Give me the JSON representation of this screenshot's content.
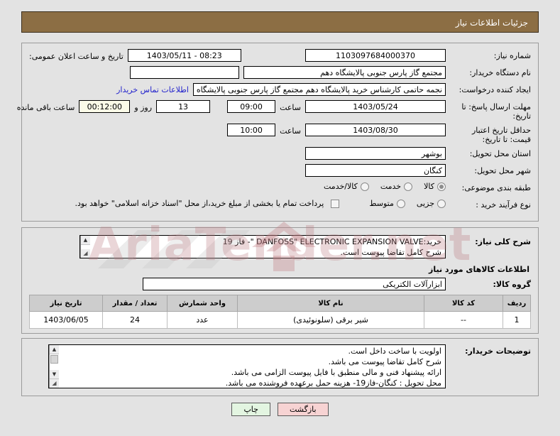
{
  "header": {
    "title": "جزئیات اطلاعات نیاز"
  },
  "watermark": {
    "text": "AriaTender.net"
  },
  "need_info": {
    "need_number_label": "شماره نیاز:",
    "need_number_value": "1103097684000370",
    "public_announce_label": "تاریخ و ساعت اعلان عمومی:",
    "public_announce_value": "08:23 - 1403/05/11",
    "buyer_org_label": "نام دستگاه خریدار:",
    "buyer_org_value": "مجتمع گاز پارس جنوبی  پالایشگاه دهم",
    "buyer_org_extra_value": "",
    "requester_label": "ایجاد کننده درخواست:",
    "requester_value": "نجمه حاتمی کارشناس خرید پالایشگاه دهم  مجتمع گاز پارس جنوبی  پالایشگاه دهم",
    "contact_link": "اطلاعات تماس خریدار",
    "deadline_label": "مهلت ارسال پاسخ: تا تاریخ:",
    "deadline_date": "1403/05/24",
    "deadline_hour_label": "ساعت",
    "deadline_hour": "09:00",
    "remaining_days": "13",
    "remaining_days_label": "روز و",
    "remaining_clock": "00:12:00",
    "remaining_suffix": "ساعت باقی مانده",
    "price_validity_label": "حداقل تاریخ اعتبار قیمت: تا تاریخ:",
    "price_validity_date": "1403/08/30",
    "price_validity_hour_label": "ساعت",
    "price_validity_hour": "10:00",
    "province_label": "استان محل تحویل:",
    "province_value": "بوشهر",
    "city_label": "شهر محل تحویل:",
    "city_value": "کنگان",
    "subject_class_label": "طبقه بندی موضوعی:",
    "subject_options": [
      {
        "label": "کالا",
        "selected": true
      },
      {
        "label": "خدمت",
        "selected": false
      },
      {
        "label": "کالا/خدمت",
        "selected": false
      }
    ],
    "process_type_label": "نوع فرآیند خرید :",
    "process_options": [
      {
        "label": "جزیی",
        "selected": false
      },
      {
        "label": "متوسط",
        "selected": false
      }
    ],
    "treasury_checkbox_checked": false,
    "treasury_note": "پرداخت تمام یا بخشی از مبلغ خرید،از محل \"اسناد خزانه اسلامی\" خواهد بود."
  },
  "description": {
    "label": "شرح کلی نیاز:",
    "lines": [
      "خرید:DANFOSS\" ELECTRONIC EXPANSION VALVE \"- فاز 19",
      "شرح کامل تقاضا پیوست است."
    ]
  },
  "goods_section": {
    "heading": "اطلاعات کالاهای مورد نیاز",
    "group_label": "گروه کالا:",
    "group_value": "ابزارآلات الکتریکی",
    "columns": [
      "ردیف",
      "کد کالا",
      "نام کالا",
      "واحد شمارش",
      "تعداد / مقدار",
      "تاریخ نیاز"
    ],
    "rows": [
      {
        "index": "1",
        "code": "--",
        "name": "شیر برقی (سلونوئیدی)",
        "unit": "عدد",
        "qty": "24",
        "date": "1403/06/05"
      }
    ]
  },
  "buyer_notes": {
    "label": "توضیحات خریدار:",
    "lines": [
      "اولویت با ساخت داخل است.",
      "شرح کامل تقاضا پیوست می باشد.",
      "ارائه پیشنهاد فنی و مالی منطبق با فایل پیوست الزامی می باشد.",
      "محل تحویل : کنگان-فاز19- هزینه حمل برعهده فروشنده می باشد."
    ]
  },
  "footer": {
    "print_label": "چاپ",
    "back_label": "بازگشت"
  },
  "icons": {
    "scroll_up": "▲",
    "scroll_down": "▼",
    "resize_grip": "◢"
  },
  "colors": {
    "header_bg": "#8c6e44",
    "page_bg": "#e3e3e3",
    "link": "#2222cc",
    "print_btn": "#e3f5e1",
    "back_btn": "#f7d3d3"
  }
}
